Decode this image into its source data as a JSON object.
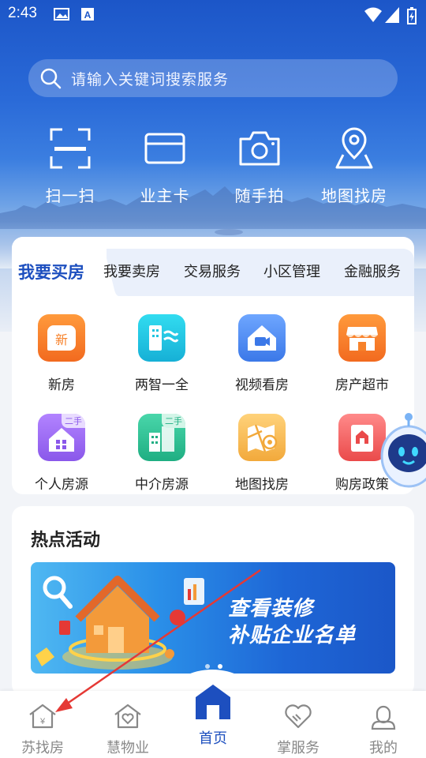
{
  "status_bar": {
    "time": "2:43"
  },
  "search": {
    "placeholder": "请输入关键词搜索服务"
  },
  "quick_actions": [
    {
      "label": "扫一扫",
      "icon": "scan-icon"
    },
    {
      "label": "业主卡",
      "icon": "card-icon"
    },
    {
      "label": "随手拍",
      "icon": "camera-icon"
    },
    {
      "label": "地图找房",
      "icon": "map-pin-icon"
    }
  ],
  "tabs": [
    {
      "label": "我要买房",
      "active": true
    },
    {
      "label": "我要卖房"
    },
    {
      "label": "交易服务"
    },
    {
      "label": "小区管理"
    },
    {
      "label": "金融服务"
    }
  ],
  "grid": [
    {
      "label": "新房",
      "icon": "new-house-icon",
      "icon_text": "新",
      "color": "#f7822a"
    },
    {
      "label": "两智一全",
      "icon": "smart-building-icon",
      "color": "#1fc5e0"
    },
    {
      "label": "视频看房",
      "icon": "video-house-icon",
      "color": "#4a8ef0"
    },
    {
      "label": "房产超市",
      "icon": "shop-icon",
      "color": "#f7822a"
    },
    {
      "label": "个人房源",
      "icon": "personal-house-icon",
      "tag": "二手",
      "color": "#9a6cf0"
    },
    {
      "label": "中介房源",
      "icon": "agency-building-icon",
      "tag": "二手",
      "color": "#2fc295"
    },
    {
      "label": "地图找房",
      "icon": "map-house-icon",
      "color": "#f6b84b"
    },
    {
      "label": "购房政策",
      "icon": "policy-icon",
      "color": "#f25c5c"
    }
  ],
  "hot": {
    "title": "热点活动",
    "banner_line1": "查看装修",
    "banner_line2": "补贴企业名单",
    "page_count": 2,
    "current_page": 2
  },
  "bottom_nav": [
    {
      "label": "苏找房",
      "icon": "house-yuan-icon"
    },
    {
      "label": "慧物业",
      "icon": "house-heart-icon"
    },
    {
      "label": "首页",
      "icon": "home-icon",
      "active": true
    },
    {
      "label": "掌服务",
      "icon": "handshake-heart-icon"
    },
    {
      "label": "我的",
      "icon": "user-icon"
    }
  ],
  "colors": {
    "primary": "#1d4fbf",
    "annotation_arrow": "#e53935"
  }
}
